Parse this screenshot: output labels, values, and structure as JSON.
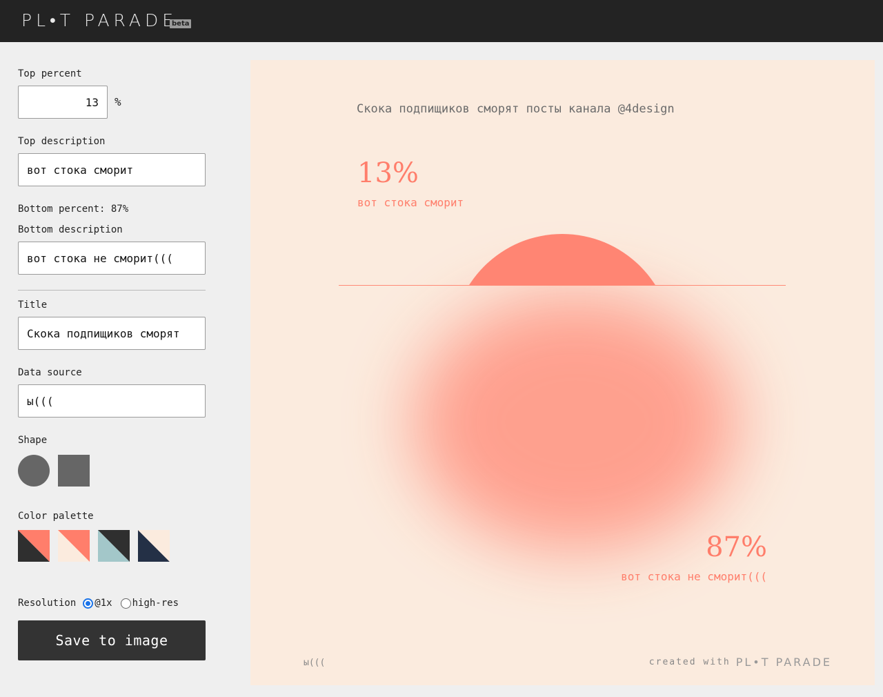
{
  "header": {
    "logo": "PL•T PARADE",
    "badge": "beta"
  },
  "sidebar": {
    "top_percent": {
      "label": "Top percent",
      "value": "13",
      "unit": "%"
    },
    "top_description": {
      "label": "Top description",
      "value": "вот стока сморит"
    },
    "bottom_percent_text": "Bottom percent: 87%",
    "bottom_description": {
      "label": "Bottom description",
      "value": "вот стока не сморит((("
    },
    "title": {
      "label": "Title",
      "value": "Скока подпищиков сморят"
    },
    "data_source": {
      "label": "Data source",
      "value": "ы((("
    },
    "shape": {
      "label": "Shape",
      "options": [
        "circle",
        "square"
      ],
      "selected": "circle"
    },
    "color_palette": {
      "label": "Color palette",
      "swatches": [
        [
          "#2f2f2f",
          "#ff7e6b"
        ],
        [
          "#fbebde",
          "#ff7e6b"
        ],
        [
          "#a3c7c9",
          "#2f2f2f"
        ],
        [
          "#243046",
          "#fbebde"
        ]
      ]
    },
    "resolution": {
      "label": "Resolution",
      "options": [
        "@1x",
        "high-res"
      ],
      "selected": "@1x"
    },
    "save_label": "Save to image"
  },
  "canvas": {
    "title": "Скока подпищиков сморят посты канала @4design",
    "top_percent": "13%",
    "top_description": "вот стока сморит",
    "bottom_percent": "87%",
    "bottom_description": "вот стока не сморит(((",
    "source": "ы(((",
    "credit_prefix": "created with",
    "credit_logo": "PL•T PARADE",
    "colors": {
      "background": "#fbebde",
      "accent": "#ff7e6b"
    }
  }
}
